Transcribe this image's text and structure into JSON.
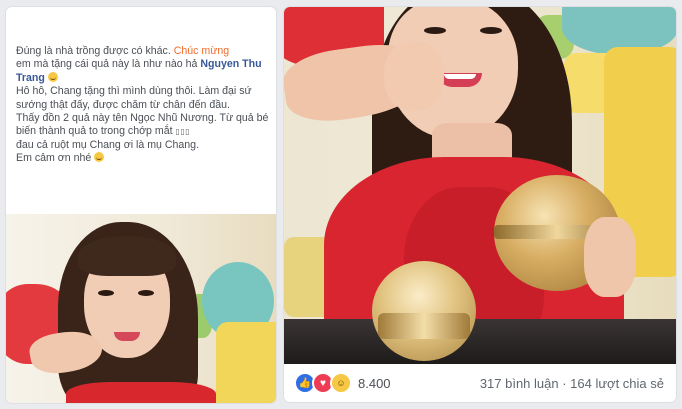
{
  "left_post": {
    "line1_a": "Đúng là nhà trồng được có khác. ",
    "line1_highlight": "Chúc mừng",
    "line2_a": "em mà tặng cái quả này là như nào hả ",
    "line2_name": "Nguyen Thu Trang",
    "line3": "Hô hô, Chang tặng thì mình dùng thôi. Làm đại sứ sướng thật đấy, được chăm từ chân đến đầu.",
    "line4": "Thấy đồn 2 quả này tên Ngọc Nhũ Nương. Từ quả bé biến thành quả to trong chớp mắt ",
    "line4_boxes": "▯▯▯",
    "line5": "đau cả ruột mụ Chang ơi là mụ Chang.",
    "line6": "Em cảm ơn nhé "
  },
  "right_post": {
    "reaction_icons": [
      "like-icon",
      "love-icon",
      "haha-icon"
    ],
    "reaction_count": "8.400",
    "stats": "317 bình luận · 164 lượt chia sẻ"
  },
  "colors": {
    "highlight": "#f36b2b",
    "name_link": "#385898",
    "like": "#2f6ee6",
    "love": "#ef3c55",
    "haha": "#f7c844"
  }
}
